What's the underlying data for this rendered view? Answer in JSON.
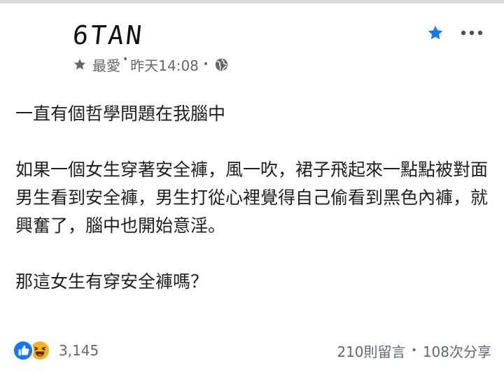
{
  "post": {
    "author": "6TAN",
    "meta": {
      "audience": "最愛",
      "timestamp": "昨天14:08"
    },
    "paragraphs": [
      "一直有個哲學問題在我腦中",
      "如果一個女生穿著安全褲，風一吹，裙子飛起來一點點被對面男生看到安全褲，男生打從心裡覺得自己偷看到黑色內褲，就興奮了，腦中也開始意淫。",
      "那這女生有穿安全褲嗎？"
    ],
    "reactions": {
      "count": "3,145",
      "types": [
        "like-icon",
        "haha-icon"
      ]
    },
    "comments": "210則留言",
    "shares": "108次分享",
    "separator": "•"
  },
  "colors": {
    "accent": "#1877f2",
    "meta_text": "#65676b",
    "body_text": "#1c1e21",
    "haha": "#f7b125"
  }
}
